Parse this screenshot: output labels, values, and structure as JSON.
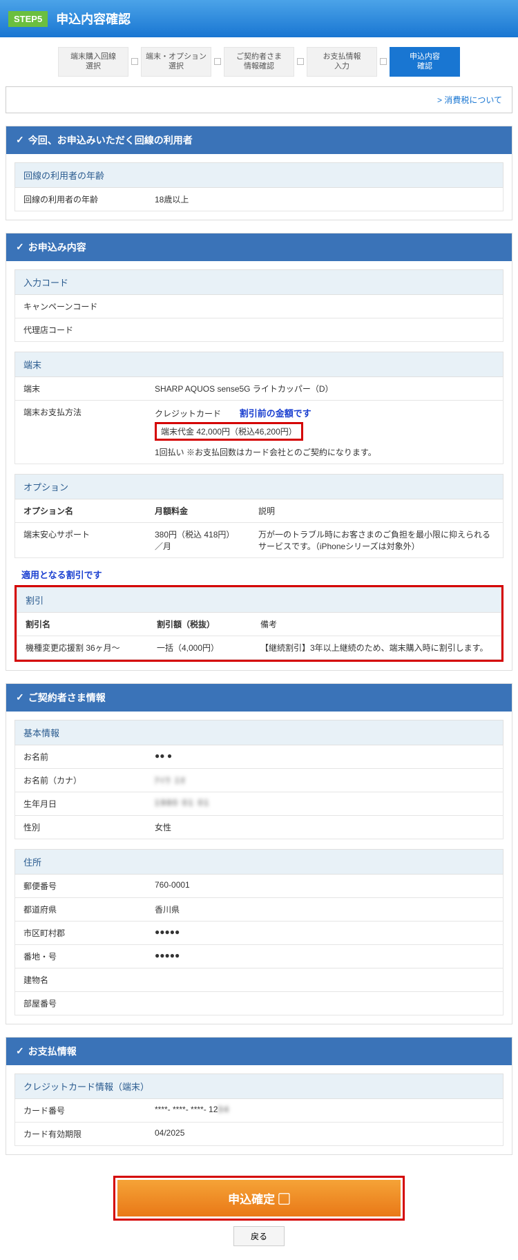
{
  "header": {
    "step": "STEP5",
    "title": "申込内容確認"
  },
  "steps": [
    "端末購入回線\n選択",
    "端末・オプション\n選択",
    "ご契約者さま\n情報確認",
    "お支払情報\n入力",
    "申込内容\n確認"
  ],
  "tax_link": "消費税について",
  "sec_line": {
    "title": "今回、お申込みいただく回線の利用者",
    "sub": "回線の利用者の年齢",
    "row_lbl": "回線の利用者の年齢",
    "row_val": "18歳以上"
  },
  "sec_app": {
    "title": "お申込み内容",
    "code": {
      "sub": "入力コード",
      "r1": "キャンペーンコード",
      "r2": "代理店コード"
    },
    "device": {
      "sub": "端末",
      "r1_lbl": "端末",
      "r1_val": "SHARP AQUOS sense5G ライトカッパー（D）",
      "r2_lbl": "端末お支払方法",
      "r2_v1": "クレジットカード",
      "annot": "割引前の金額です",
      "box": "端末代金  42,000円（税込46,200円）",
      "r2_v3": "1回払い ※お支払回数はカード会社とのご契約になります。"
    },
    "option": {
      "sub": "オプション",
      "h1": "オプション名",
      "h2": "月額料金",
      "h3": "説明",
      "r1": "端末安心サポート",
      "r2": "380円（税込 418円）／月",
      "r3": "万が一のトラブル時にお客さまのご負担を最小限に抑えられるサービスです。（iPhoneシリーズは対象外）"
    },
    "discount": {
      "annot": "適用となる割引です",
      "sub": "割引",
      "h1": "割引名",
      "h2": "割引額（税抜）",
      "h3": "備考",
      "r1": "機種変更応援割  36ヶ月～",
      "r2": "一括（4,000円）",
      "r3": "【継続割引】3年以上継続のため、端末購入時に割引します。"
    }
  },
  "sec_cust": {
    "title": "ご契約者さま情報",
    "basic": {
      "sub": "基本情報",
      "r1l": "お名前",
      "r1v": "●● ●",
      "r2l": "お名前（カナ）",
      "r2v": "ｱｲｳ ｴｵ",
      "r3l": "生年月日",
      "r3v": "1980 01 01",
      "r4l": "性別",
      "r4v": "女性"
    },
    "addr": {
      "sub": "住所",
      "r1l": "郵便番号",
      "r1v": "760-0001",
      "r2l": "都道府県",
      "r2v": "香川県",
      "r3l": "市区町村郡",
      "r3v": "●●●●●",
      "r4l": "番地・号",
      "r4v": "●●●●●",
      "r5l": "建物名",
      "r6l": "部屋番号"
    }
  },
  "sec_pay": {
    "title": "お支払情報",
    "sub": "クレジットカード情報（端末）",
    "r1l": "カード番号",
    "r1v": "****- ****- ****- 12",
    "r2l": "カード有効期限",
    "r2v": "04/2025"
  },
  "buttons": {
    "confirm": "申込確定 ▢",
    "back": "戻る"
  }
}
